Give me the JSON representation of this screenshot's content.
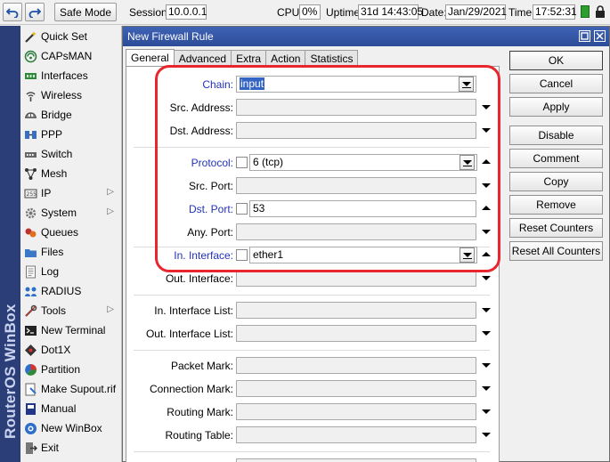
{
  "toolbar": {
    "undo_icon": "undo-icon",
    "redo_icon": "redo-icon",
    "safe_mode_label": "Safe Mode",
    "session_label": "Session:",
    "session_value": "10.0.0.1",
    "cpu_label": "CPU:",
    "cpu_value": "0%",
    "uptime_label": "Uptime:",
    "uptime_value": "31d 14:43:05",
    "date_label": "Date:",
    "date_value": "Jan/29/2021",
    "time_label": "Time:",
    "time_value": "17:52:31",
    "colors": {
      "green_indicator": "#2e9e2e",
      "lock": "#222222"
    }
  },
  "sidebar": {
    "brand_text": "RouterOS WinBox",
    "colors": {
      "bar": "#2c3e78",
      "bar_text": "#c9d3ee"
    },
    "items": [
      {
        "label": "Quick Set",
        "icon": "wand-icon",
        "submenu": false
      },
      {
        "label": "CAPsMAN",
        "icon": "capsman-icon",
        "submenu": false
      },
      {
        "label": "Interfaces",
        "icon": "interfaces-icon",
        "submenu": false
      },
      {
        "label": "Wireless",
        "icon": "wireless-icon",
        "submenu": false
      },
      {
        "label": "Bridge",
        "icon": "bridge-icon",
        "submenu": false
      },
      {
        "label": "PPP",
        "icon": "ppp-icon",
        "submenu": false
      },
      {
        "label": "Switch",
        "icon": "switch-icon",
        "submenu": false
      },
      {
        "label": "Mesh",
        "icon": "mesh-icon",
        "submenu": false
      },
      {
        "label": "IP",
        "icon": "ip-icon",
        "submenu": true
      },
      {
        "label": "System",
        "icon": "gear-icon",
        "submenu": true
      },
      {
        "label": "Queues",
        "icon": "queues-icon",
        "submenu": false
      },
      {
        "label": "Files",
        "icon": "folder-icon",
        "submenu": false
      },
      {
        "label": "Log",
        "icon": "log-icon",
        "submenu": false
      },
      {
        "label": "RADIUS",
        "icon": "radius-icon",
        "submenu": false
      },
      {
        "label": "Tools",
        "icon": "tools-icon",
        "submenu": true
      },
      {
        "label": "New Terminal",
        "icon": "terminal-icon",
        "submenu": false
      },
      {
        "label": "Dot1X",
        "icon": "dot1x-icon",
        "submenu": false
      },
      {
        "label": "Partition",
        "icon": "partition-icon",
        "submenu": false
      },
      {
        "label": "Make Supout.rif",
        "icon": "supout-icon",
        "submenu": false
      },
      {
        "label": "Manual",
        "icon": "manual-icon",
        "submenu": false
      },
      {
        "label": "New WinBox",
        "icon": "winbox-icon",
        "submenu": false
      },
      {
        "label": "Exit",
        "icon": "exit-icon",
        "submenu": false
      }
    ]
  },
  "dialog": {
    "title": "New Firewall Rule",
    "tabs": [
      {
        "label": "General",
        "active": true
      },
      {
        "label": "Advanced",
        "active": false
      },
      {
        "label": "Extra",
        "active": false
      },
      {
        "label": "Action",
        "active": false
      },
      {
        "label": "Statistics",
        "active": false
      }
    ],
    "fields": {
      "chain": {
        "label": "Chain:",
        "value": "input"
      },
      "src_address": {
        "label": "Src. Address:",
        "value": ""
      },
      "dst_address": {
        "label": "Dst. Address:",
        "value": ""
      },
      "protocol": {
        "label": "Protocol:",
        "value": "6 (tcp)"
      },
      "src_port": {
        "label": "Src. Port:",
        "value": ""
      },
      "dst_port": {
        "label": "Dst. Port:",
        "value": "53"
      },
      "any_port": {
        "label": "Any. Port:",
        "value": ""
      },
      "in_interface": {
        "label": "In. Interface:",
        "value": "ether1"
      },
      "out_interface": {
        "label": "Out. Interface:",
        "value": ""
      },
      "in_interface_list": {
        "label": "In. Interface List:",
        "value": ""
      },
      "out_interface_list": {
        "label": "Out. Interface List:",
        "value": ""
      },
      "packet_mark": {
        "label": "Packet Mark:",
        "value": ""
      },
      "connection_mark": {
        "label": "Connection Mark:",
        "value": ""
      },
      "routing_mark": {
        "label": "Routing Mark:",
        "value": ""
      },
      "routing_table": {
        "label": "Routing Table:",
        "value": ""
      }
    },
    "buttons": {
      "ok": "OK",
      "cancel": "Cancel",
      "apply": "Apply",
      "disable": "Disable",
      "comment": "Comment",
      "copy": "Copy",
      "remove": "Remove",
      "reset_counters": "Reset Counters",
      "reset_all_counters": "Reset All Counters"
    },
    "colors": {
      "title_bar": "#2f50a0",
      "active_label": "#2233b8",
      "highlight": "#e8262e",
      "selection": "#3465c5"
    }
  }
}
